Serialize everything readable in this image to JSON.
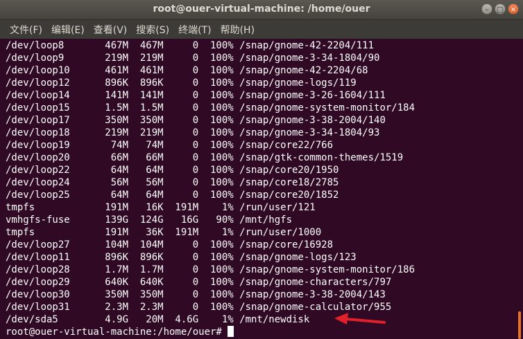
{
  "window": {
    "title": "root@ouer-virtual-machine: /home/ouer"
  },
  "menu": [
    "文件(F)",
    "编辑(E)",
    "查看(V)",
    "搜索(S)",
    "终端(T)",
    "帮助(H)"
  ],
  "terminal_lines": [
    "/dev/loop8       467M  467M     0  100% /snap/gnome-42-2204/111",
    "/dev/loop9       219M  219M     0  100% /snap/gnome-3-34-1804/90",
    "/dev/loop10      461M  461M     0  100% /snap/gnome-42-2204/68",
    "/dev/loop12      896K  896K     0  100% /snap/gnome-logs/119",
    "/dev/loop14      141M  141M     0  100% /snap/gnome-3-26-1604/111",
    "/dev/loop15      1.5M  1.5M     0  100% /snap/gnome-system-monitor/184",
    "/dev/loop17      350M  350M     0  100% /snap/gnome-3-38-2004/140",
    "/dev/loop18      219M  219M     0  100% /snap/gnome-3-34-1804/93",
    "/dev/loop19       74M   74M     0  100% /snap/core22/766",
    "/dev/loop20       66M   66M     0  100% /snap/gtk-common-themes/1519",
    "/dev/loop22       64M   64M     0  100% /snap/core20/1950",
    "/dev/loop24       56M   56M     0  100% /snap/core18/2785",
    "/dev/loop25       64M   64M     0  100% /snap/core20/1852",
    "tmpfs            191M   16K  191M    1% /run/user/121",
    "vmhgfs-fuse      139G  124G   16G   90% /mnt/hgfs",
    "tmpfs            191M   36K  191M    1% /run/user/1000",
    "/dev/loop27      104M  104M     0  100% /snap/core/16928",
    "/dev/loop11      896K  896K     0  100% /snap/gnome-logs/123",
    "/dev/loop28      1.7M  1.7M     0  100% /snap/gnome-system-monitor/186",
    "/dev/loop29      640K  640K     0  100% /snap/gnome-characters/797",
    "/dev/loop30      350M  350M     0  100% /snap/gnome-3-38-2004/143",
    "/dev/loop31      2.3M  2.3M     0  100% /snap/gnome-calculator/955",
    "/dev/sda5        4.9G   20M  4.6G    1% /mnt/newdisk"
  ],
  "prompt": "root@ouer-virtual-machine:/home/ouer# ",
  "colors": {
    "terminal_bg": "#300a24",
    "text": "#ffffff",
    "annotation_arrow": "#e0202a",
    "scroll_thumb": "#e9722a"
  }
}
